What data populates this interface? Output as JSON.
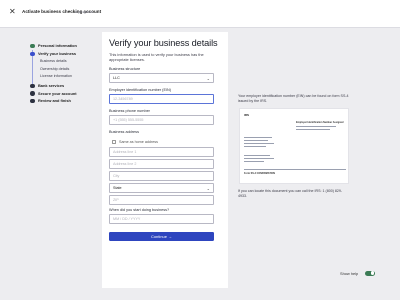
{
  "topbar": {
    "close_icon": "close-icon",
    "title": "Activate business checking account",
    "progress": "8 progress"
  },
  "sidebar": {
    "steps": [
      {
        "label": "Personal information",
        "state": "done"
      },
      {
        "label": "Verify your business",
        "state": "active"
      },
      {
        "label": "Bank services",
        "state": "todo"
      },
      {
        "label": "Secure your account",
        "state": "todo"
      },
      {
        "label": "Review and finish",
        "state": "todo"
      }
    ],
    "substeps": [
      "Business details",
      "Ownership details",
      "License information"
    ]
  },
  "form": {
    "title": "Verify your business details",
    "intro": "This information is used to verify your business has the appropriate licenses.",
    "business_structure": {
      "label": "Business structure",
      "value": "LLC"
    },
    "ein": {
      "label": "Employer identification number (EIN)",
      "placeholder": "12-3456789"
    },
    "phone": {
      "label": "Business phone number",
      "placeholder": "+1 (555) 555-5555"
    },
    "address": {
      "label": "Business address",
      "same_as_home": "Same as home address",
      "line1": "Address line 1",
      "line2": "Address line 2",
      "city": "City",
      "state": "State",
      "zip": "ZIP"
    },
    "start_date": {
      "label": "When did you start doing business?",
      "placeholder": "MM / DD / YYYY"
    },
    "continue_label": "Continue →"
  },
  "help": {
    "ein_text": "Your employer identification number (EIN) can be found on form SS-4 issued by the IRS.",
    "doc_header": "IRS",
    "doc_title": "Employer Identification Number Assigned",
    "doc_footer": "Form SS-4 CONFIRMATION",
    "locate_text": "If you can locate this document you can call the IRS: 1 (800) 829-4933."
  },
  "footer": {
    "show_help_label": "Show help",
    "show_help_on": true
  },
  "colors": {
    "primary": "#2e45bf",
    "done": "#3b7b55",
    "active": "#3a4fcc",
    "toggle_on": "#3b7b55"
  }
}
